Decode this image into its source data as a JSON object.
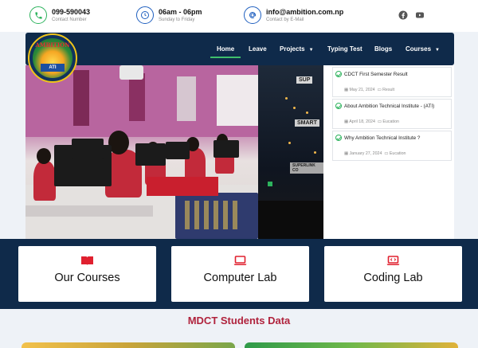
{
  "contacts": [
    {
      "icon": "phone-icon",
      "main": "099-590043",
      "sub": "Contact Number",
      "color": "#2db35d"
    },
    {
      "icon": "clock-icon",
      "main": "06am - 06pm",
      "sub": "Sunday to Friday",
      "color": "#1f5fbf"
    },
    {
      "icon": "at-icon",
      "main": "info@ambition.com.np",
      "sub": "Contact by E-Mail",
      "color": "#1f5fbf"
    }
  ],
  "social": [
    "facebook-icon",
    "youtube-icon"
  ],
  "logo": {
    "top_text": "AMBITION",
    "badge": "ATI"
  },
  "nav": {
    "items": [
      {
        "label": "Home",
        "active": true
      },
      {
        "label": "Leave"
      },
      {
        "label": "Projects",
        "dropdown": true
      },
      {
        "label": "Typing Test"
      },
      {
        "label": "Blogs"
      },
      {
        "label": "Courses",
        "dropdown": true
      }
    ]
  },
  "hero": {
    "right_sign": "SMART",
    "right_sign2": "SUP",
    "right_sign3": "SUPERLINK CO"
  },
  "posts": [
    {
      "title": "CDCT First Semester Result",
      "date": "May 21, 2024",
      "category": "Result"
    },
    {
      "title": "About Ambition Technical Institute - (ATI)",
      "date": "April 18, 2024",
      "category": "Eucation"
    },
    {
      "title": "Why Ambition Technical Institute ?",
      "date": "January 27, 2024",
      "category": "Eucation"
    }
  ],
  "features": [
    {
      "label": "Our Courses",
      "icon": "book-icon"
    },
    {
      "label": "Computer Lab",
      "icon": "laptop-icon"
    },
    {
      "label": "Coding Lab",
      "icon": "code-laptop-icon"
    }
  ],
  "students": {
    "title": "MDCT Students Data"
  },
  "colors": {
    "navy": "#0f2a4a",
    "accent_green": "#3fbf6b",
    "accent_red": "#e0202f",
    "title_red": "#b0233d"
  }
}
